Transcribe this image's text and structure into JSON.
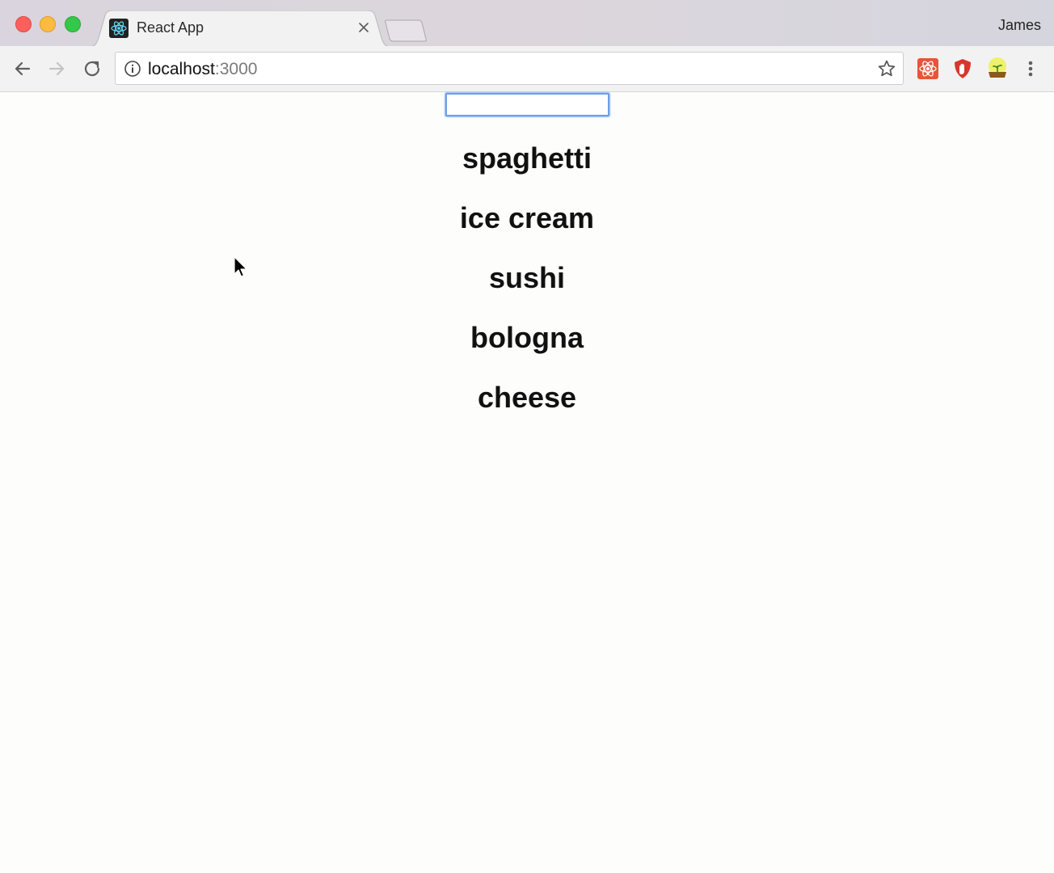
{
  "browser": {
    "profile_name": "James",
    "tab": {
      "title": "React App",
      "favicon": "react-logo-icon"
    },
    "address_bar": {
      "host": "localhost",
      "port": ":3000"
    },
    "toolbar_icons": [
      "back-arrow-icon",
      "forward-arrow-icon",
      "reload-icon",
      "info-icon",
      "bookmark-star-icon"
    ],
    "extensions": [
      "react-devtools-extension-icon",
      "ublock-extension-icon",
      "plant-extension-icon"
    ],
    "colors": {
      "traffic_close": "#fc605c",
      "traffic_minimize": "#fdbc40",
      "traffic_maximize": "#34c84a",
      "input_focus": "#6f9fe6"
    }
  },
  "page": {
    "search": {
      "value": "",
      "placeholder": ""
    },
    "foods": [
      "spaghetti",
      "ice cream",
      "sushi",
      "bologna",
      "cheese"
    ]
  }
}
